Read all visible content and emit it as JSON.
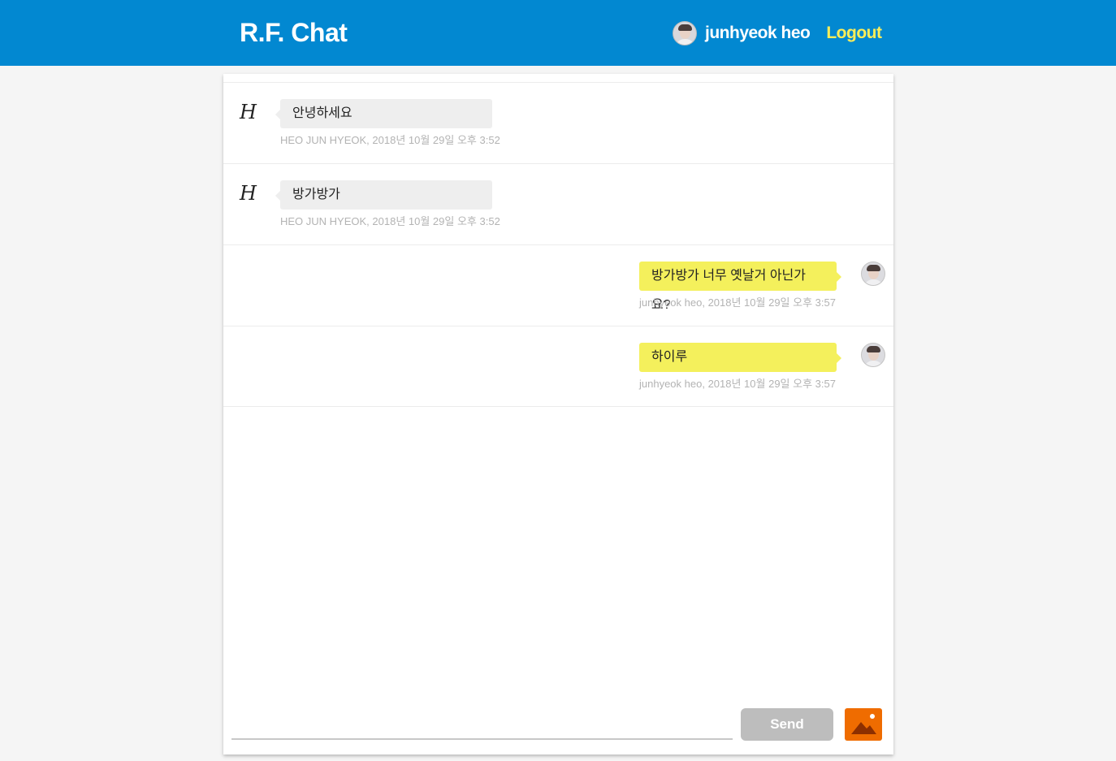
{
  "header": {
    "brand": "R.F. Chat",
    "user_name": "junhyeok heo",
    "logout_label": "Logout"
  },
  "messages": [
    {
      "text": "안녕하세요",
      "meta": "HEO JUN HYEOK, 2018년 10월 29일 오후 3:52",
      "side": "other",
      "avatar": "H"
    },
    {
      "text": "방가방가",
      "meta": "HEO JUN HYEOK, 2018년 10월 29일 오후 3:52",
      "side": "other",
      "avatar": "H"
    },
    {
      "text": "방가방가 너무 옛날거 아닌가요?",
      "meta": "junhyeok heo, 2018년 10월 29일 오후 3:57",
      "side": "mine"
    },
    {
      "text": "하이루",
      "meta": "junhyeok heo, 2018년 10월 29일 오후 3:57",
      "side": "mine"
    }
  ],
  "composer": {
    "value": "",
    "send_label": "Send",
    "image_icon": "image-icon"
  },
  "colors": {
    "header": "#0288d1",
    "logout": "#ffee58",
    "own_bubble": "#f4f05c",
    "other_bubble": "#eeeeee",
    "send_button": "#bdbdbd",
    "image_button": "#ef6c00"
  }
}
